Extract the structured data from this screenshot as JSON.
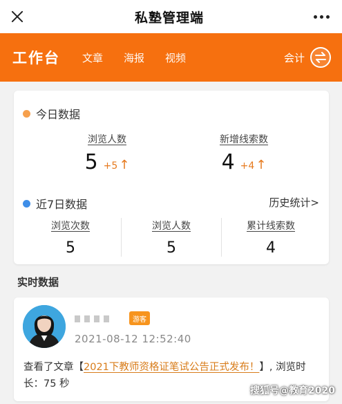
{
  "topbar": {
    "title": "私塾管理端",
    "close_icon": "close-icon",
    "more_icon": "more-icon"
  },
  "navbar": {
    "brand": "工作台",
    "tabs": [
      "文章",
      "海报",
      "视频"
    ],
    "account": "会计",
    "swap_icon": "swap-icon",
    "color": "#f6700f"
  },
  "today": {
    "title": "今日数据",
    "dot_color": "#f6a04d",
    "views": {
      "label": "浏览人数",
      "value": "5",
      "delta": "+5"
    },
    "leads": {
      "label": "新增线索数",
      "value": "4",
      "delta": "+4"
    },
    "arrow": "↑"
  },
  "week": {
    "title": "近7日数据",
    "dot_color": "#3f8ee8",
    "history_link": "历史统计>",
    "columns": [
      {
        "label": "浏览次数",
        "value": "5"
      },
      {
        "label": "浏览人数",
        "value": "5"
      },
      {
        "label": "累计线索数",
        "value": "4"
      }
    ]
  },
  "realtime": {
    "title": "实时数据",
    "visitor_badge": "游客",
    "time": "2021-08-12 12:52:40",
    "action_prefix": "查看了文章【",
    "article_title": "2021下教师资格证笔试公告正式发布！",
    "action_suffix": "】, 浏览时长：75 秒"
  },
  "watermark": "搜狐号@教育2020"
}
